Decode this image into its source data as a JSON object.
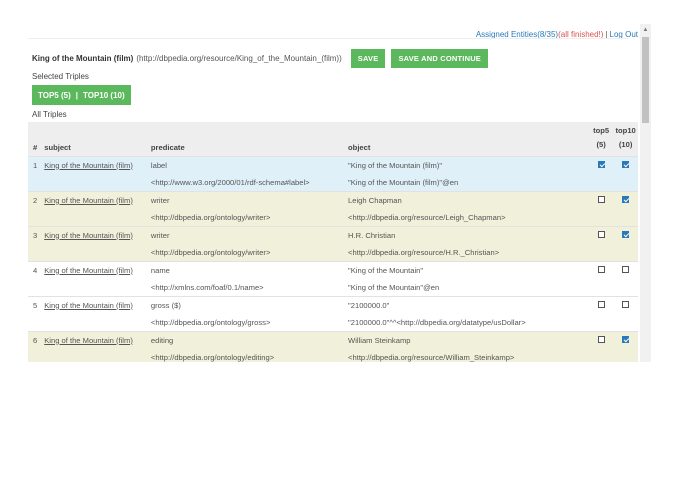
{
  "header": {
    "assigned_link": "Assigned Entities(8/35)",
    "finished_text": "(all finished!)",
    "separator": "|",
    "logout_link": "Log Out"
  },
  "entity": {
    "name": "King of the Mountain (film)",
    "uri": "(http://dbpedia.org/resource/King_of_the_Mountain_(film))",
    "save_label": "SAVE",
    "save_continue_label": "SAVE AND CONTINUE"
  },
  "selected": {
    "label": "Selected Triples",
    "top5_tab": "TOP5 (5)",
    "tab_sep": "|",
    "top10_tab": "TOP10 (10)"
  },
  "all": {
    "label": "All Triples",
    "columns": {
      "num": "#",
      "subject": "subject",
      "predicate": "predicate",
      "object": "object",
      "top5_a": "top5",
      "top5_b": "(5)",
      "top10_a": "top10",
      "top10_b": "(10)"
    },
    "rows": [
      {
        "num": "1",
        "subject": "King of the Mountain (film)",
        "pred_label": "label",
        "pred_uri": "<http://www.w3.org/2000/01/rdf-schema#label>",
        "obj_label": "\"King of the Mountain (film)\"",
        "obj_uri": "\"King of the Mountain (film)\"@en",
        "top5": true,
        "top10": true,
        "style": "hl"
      },
      {
        "num": "2",
        "subject": "King of the Mountain (film)",
        "pred_label": "writer",
        "pred_uri": "<http://dbpedia.org/ontology/writer>",
        "obj_label": "Leigh Chapman",
        "obj_uri": "<http://dbpedia.org/resource/Leigh_Chapman>",
        "top5": false,
        "top10": true,
        "style": "shade"
      },
      {
        "num": "3",
        "subject": "King of the Mountain (film)",
        "pred_label": "writer",
        "pred_uri": "<http://dbpedia.org/ontology/writer>",
        "obj_label": "H.R. Christian",
        "obj_uri": "<http://dbpedia.org/resource/H.R._Christian>",
        "top5": false,
        "top10": true,
        "style": "shade"
      },
      {
        "num": "4",
        "subject": "King of the Mountain (film)",
        "pred_label": "name",
        "pred_uri": "<http://xmlns.com/foaf/0.1/name>",
        "obj_label": "\"King of the Mountain\"",
        "obj_uri": "\"King of the Mountain\"@en",
        "top5": false,
        "top10": false,
        "style": "plain"
      },
      {
        "num": "5",
        "subject": "King of the Mountain (film)",
        "pred_label": "gross ($)",
        "pred_uri": "<http://dbpedia.org/ontology/gross>",
        "obj_label": "\"2100000.0\"",
        "obj_uri": "\"2100000.0\"^^<http://dbpedia.org/datatype/usDollar>",
        "top5": false,
        "top10": false,
        "style": "plain"
      },
      {
        "num": "6",
        "subject": "King of the Mountain (film)",
        "pred_label": "editing",
        "pred_uri": "<http://dbpedia.org/ontology/editing>",
        "obj_label": "William Steinkamp",
        "obj_uri": "<http://dbpedia.org/resource/William_Steinkamp>",
        "top5": false,
        "top10": true,
        "style": "shade"
      }
    ]
  }
}
